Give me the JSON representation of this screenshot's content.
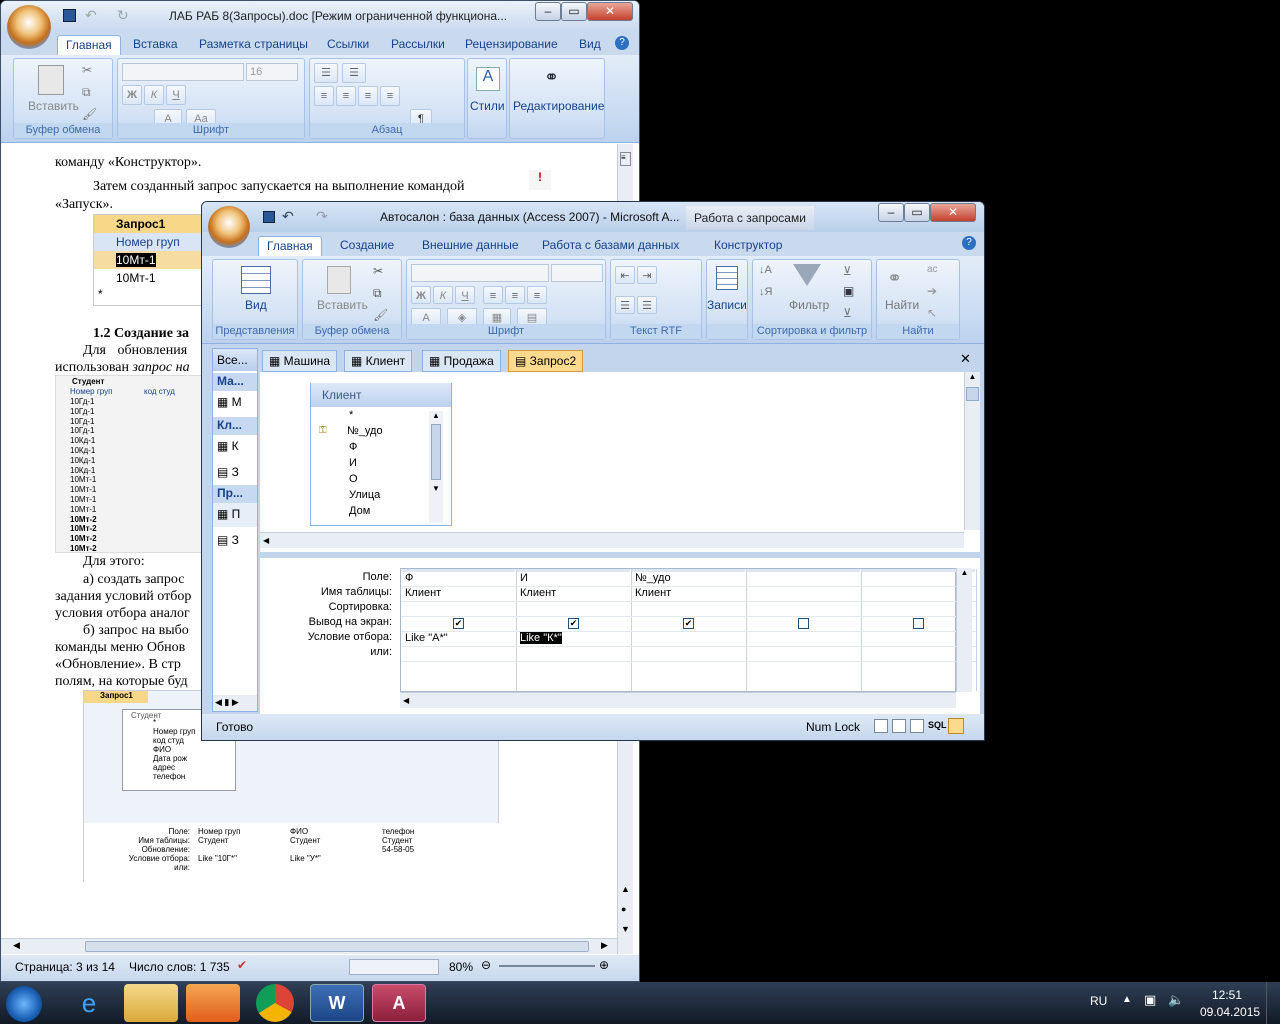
{
  "word": {
    "title": "ЛАБ РАБ 8(Запросы).doc [Режим ограниченной функциона...",
    "tabs": [
      "Главная",
      "Вставка",
      "Разметка страницы",
      "Ссылки",
      "Рассылки",
      "Рецензирование",
      "Вид"
    ],
    "groups": {
      "clipboard": "Буфер обмена",
      "font": "Шрифт",
      "paragraph": "Абзац"
    },
    "paste": "Вставить",
    "font_size": "16",
    "styles": "Стили",
    "editing": "Редактирование",
    "doc": {
      "line1": "команду «Конструктор».",
      "line2": "Затем созданный запрос запускается на выполнение командой",
      "line3": "«Запуск».",
      "q1_title": "Запрос1",
      "q1_col": "Номер груп",
      "q1_r1": "10Мт-1",
      "q1_r2": "10Мт-1",
      "q1_new": "*",
      "heading": "1.2 Создание за",
      "para1a": "Для обновления",
      "para1b": "использован",
      "para1c": "запрос на",
      "tbl_title": "Студент",
      "tbl_c1": "Номер груп",
      "tbl_c2": "код студ",
      "tbl_rows": [
        "10Гд-1",
        "10Гд-1",
        "10Гд-1",
        "10Гд-1",
        "10Кд-1",
        "10Кд-1",
        "10Кд-1",
        "10Кд-1",
        "10Мт-1",
        "10Мт-1",
        "10Мт-1",
        "10Мт-1",
        "10Мт-2",
        "10Мт-2",
        "10Мт-2",
        "10Мт-2"
      ],
      "for_this": "Для этого:",
      "la": "а) создать запрос",
      "lb": "задания условий отбор",
      "lc": "условия отбора аналог",
      "ld": "б) запрос на выбо",
      "le": "команды меню Обнов",
      "lf": "«Обновление». В стр",
      "lg": "полям, на которые буд",
      "fig_table": "Студент",
      "fig_fields": [
        "*",
        "Номер груп",
        "код студ",
        "ФИО",
        "Дата рож",
        "адрес",
        "телефон"
      ],
      "fig_rowlabels": [
        "Поле:",
        "Имя таблицы:",
        "Обновление:",
        "Условие отбора:",
        "или:"
      ],
      "fig_cols": [
        [
          "Номер груп",
          "Студент",
          "",
          "Like \"10Г*\""
        ],
        [
          "ФИО",
          "Студент",
          "",
          "Like \"У*\""
        ],
        [
          "телефон",
          "Студент",
          "54-58-05",
          ""
        ]
      ]
    },
    "status": {
      "page": "Страница: 3 из 14",
      "words": "Число слов: 1 735",
      "zoom": "80%"
    }
  },
  "access": {
    "title": "Автосалон : база данных (Access 2007)  -  Microsoft A...",
    "context_tab": "Работа с запросами",
    "tabs": [
      "Главная",
      "Создание",
      "Внешние данные",
      "Работа с базами данных",
      "Конструктор"
    ],
    "groups": [
      "Представления",
      "Буфер обмена",
      "Шрифт",
      "Текст RTF",
      "Записи",
      "Сортировка и фильтр",
      "Найти"
    ],
    "btn_view": "Вид",
    "btn_paste": "Вставить",
    "btn_records": "Записи",
    "btn_filter": "Фильтр",
    "btn_find": "Найти",
    "nav": {
      "header": "Все...",
      "sections": [
        "Ма...",
        "Кл...",
        "Пр..."
      ],
      "items": [
        "М",
        "К",
        "З",
        "П",
        "З"
      ]
    },
    "doc_tabs": [
      "Машина",
      "Клиент",
      "Продажа",
      "Запрос2"
    ],
    "table_box": {
      "title": "Клиент",
      "fields": [
        "*",
        "№_удо",
        "Ф",
        "И",
        "О",
        "Улица",
        "Дом"
      ]
    },
    "grid": {
      "row_labels": [
        "Поле:",
        "Имя таблицы:",
        "Сортировка:",
        "Вывод на экран:",
        "Условие отбора:",
        "или:"
      ],
      "columns": [
        {
          "field": "Ф",
          "table": "Клиент",
          "show": true,
          "criteria": "Like \"А*\""
        },
        {
          "field": "И",
          "table": "Клиент",
          "show": true,
          "criteria": "Like \"К*\""
        },
        {
          "field": "№_удо",
          "table": "Клиент",
          "show": true,
          "criteria": ""
        },
        {
          "field": "",
          "table": "",
          "show": false,
          "criteria": ""
        },
        {
          "field": "",
          "table": "",
          "show": false,
          "criteria": ""
        }
      ]
    },
    "status": {
      "ready": "Готово",
      "numlock": "Num Lock",
      "sql": "SQL"
    }
  },
  "taskbar": {
    "lang": "RU",
    "time": "12:51",
    "date": "09.04.2015"
  }
}
